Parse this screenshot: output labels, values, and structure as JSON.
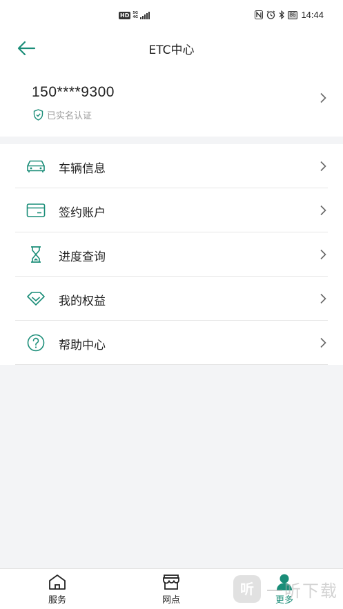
{
  "status_bar": {
    "network_badge": "HD",
    "network_type": "5G",
    "network_sub": "4G",
    "battery": "86",
    "time": "14:44",
    "icons": [
      "nfc-icon",
      "alarm-icon",
      "bluetooth-icon"
    ]
  },
  "header": {
    "title": "ETC中心",
    "back_icon": "arrow-left-icon"
  },
  "account": {
    "phone": "150****9300",
    "verified_label": "已实名认证",
    "verified_icon": "shield-check-icon"
  },
  "menu": {
    "items": [
      {
        "label": "车辆信息",
        "icon": "car-icon"
      },
      {
        "label": "签约账户",
        "icon": "card-icon"
      },
      {
        "label": "进度查询",
        "icon": "hourglass-icon"
      },
      {
        "label": "我的权益",
        "icon": "diamond-icon"
      },
      {
        "label": "帮助中心",
        "icon": "question-icon"
      }
    ]
  },
  "tabbar": {
    "tabs": [
      {
        "label": "服务",
        "icon": "home-icon",
        "active": false
      },
      {
        "label": "网点",
        "icon": "store-icon",
        "active": false
      },
      {
        "label": "更多",
        "icon": "person-icon",
        "active": true
      }
    ]
  },
  "watermark": {
    "logo": "听",
    "text": "一听下载"
  },
  "colors": {
    "accent": "#1a8d78",
    "background": "#f3f4f6",
    "divider": "#e6e6e6"
  }
}
